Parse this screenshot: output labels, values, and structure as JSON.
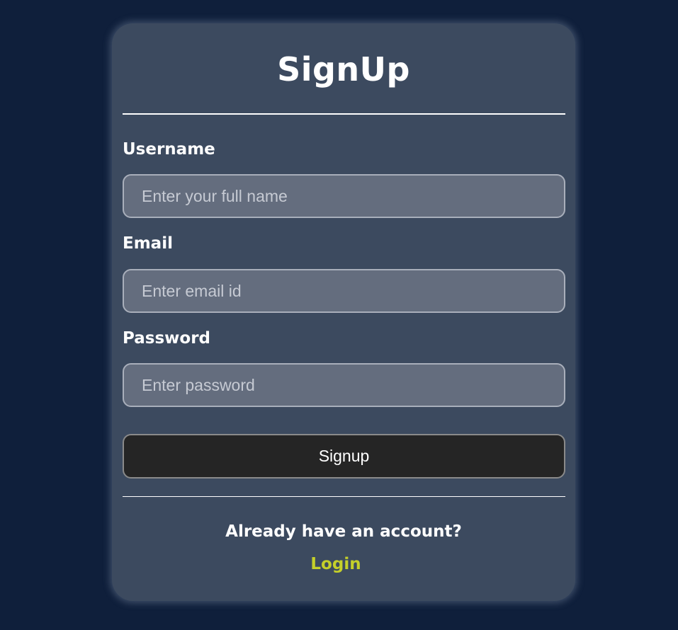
{
  "form": {
    "title": "SignUp",
    "fields": [
      {
        "label": "Username",
        "placeholder": "Enter your full name",
        "value": ""
      },
      {
        "label": "Email",
        "placeholder": "Enter email id",
        "value": ""
      },
      {
        "label": "Password",
        "placeholder": "Enter password",
        "value": ""
      }
    ],
    "submit_label": "Signup",
    "account_prompt": "Already have an account?",
    "login_label": "Login"
  },
  "colors": {
    "background": "#0f1f3b",
    "card": "#3c4a5f",
    "input_fill": "#646d7e",
    "button_fill": "#252525",
    "link": "#c5d02a",
    "text": "#ffffff"
  }
}
